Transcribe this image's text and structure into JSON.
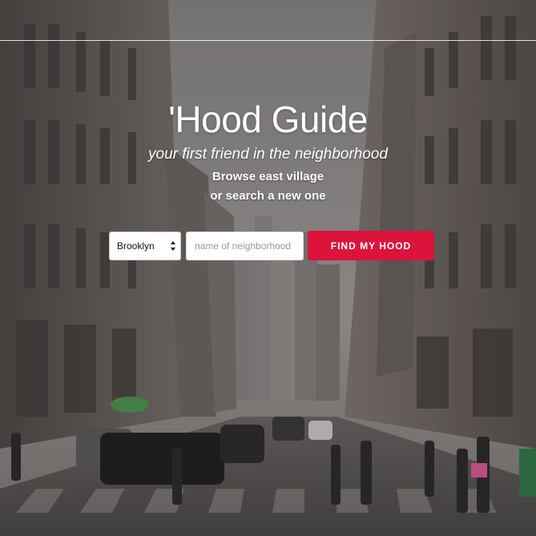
{
  "hero": {
    "title": "'Hood Guide",
    "tagline": "your first friend in the neighborhood",
    "browse_text": "Browse east village",
    "search_text": "or search a new one"
  },
  "search": {
    "borough_selected": "Brooklyn",
    "neighborhood_placeholder": "name of neighborhood",
    "neighborhood_value": "",
    "button_label": "FIND MY HOOD"
  },
  "colors": {
    "accent": "#dc143c",
    "text": "#ffffff"
  }
}
